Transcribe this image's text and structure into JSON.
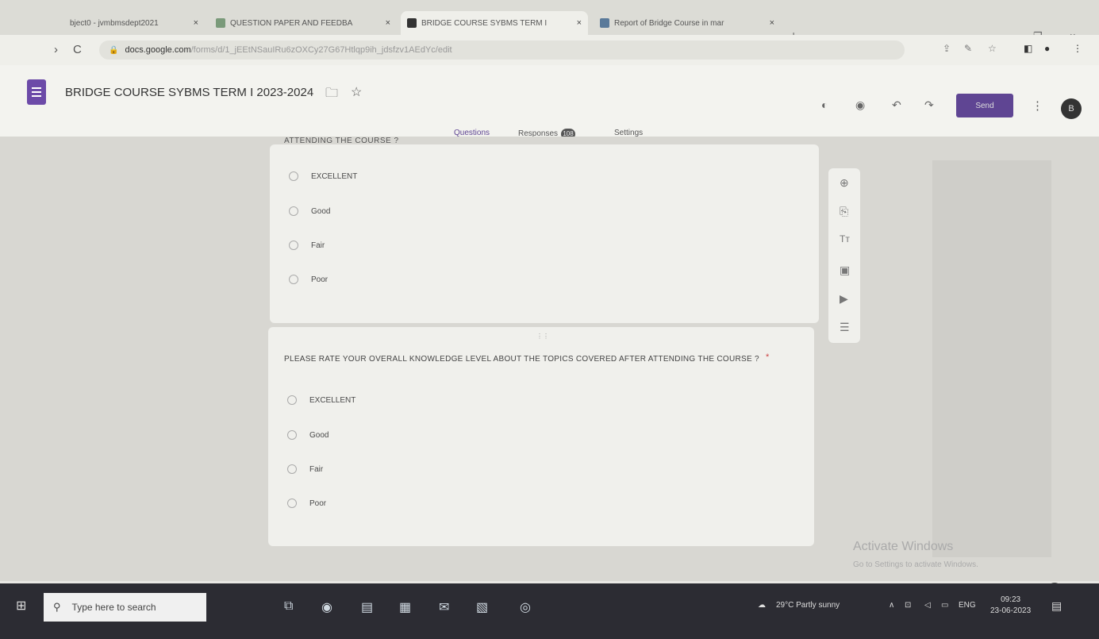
{
  "browser": {
    "tabs": [
      {
        "title": "bject0 - jvmbmsdept2021",
        "active": false
      },
      {
        "title": "QUESTION PAPER AND FEEDBA",
        "active": false
      },
      {
        "title": "BRIDGE COURSE SYBMS TERM I",
        "active": true
      },
      {
        "title": "Report of Bridge Course in mar",
        "active": false
      }
    ],
    "new_tab": "+",
    "window_controls": {
      "minimize": "–",
      "restore": "❐",
      "close": "×"
    },
    "url_domain": "docs.google.com",
    "url_path": "/forms/d/1_jEEtNSauIRu6zOXCy27G67Htlqp9ih_jdsfzv1AEdYc/edit"
  },
  "form": {
    "title": "BRIDGE COURSE SYBMS TERM I 2023-2024",
    "send_label": "Send",
    "avatar_letter": "B",
    "tabs": {
      "questions": "Questions",
      "responses": "Responses",
      "responses_count": "108",
      "settings": "Settings"
    },
    "cut_question": "ATTENDING THE COURSE ?",
    "cut_options": [
      "EXCELLENT",
      "Good",
      "Fair",
      "Poor"
    ],
    "question2": "PLEASE RATE YOUR OVERALL KNOWLEDGE LEVEL ABOUT THE TOPICS COVERED AFTER ATTENDING THE COURSE ?",
    "required_mark": "*",
    "question2_options": [
      "EXCELLENT",
      "Good",
      "Fair",
      "Poor"
    ]
  },
  "watermark": {
    "title": "Activate Windows",
    "subtitle": "Go to Settings to activate Windows."
  },
  "taskbar": {
    "search_placeholder": "Type here to search",
    "weather": "29°C Partly sunny",
    "lang": "ENG",
    "time": "09:23",
    "date": "23-06-2023"
  }
}
